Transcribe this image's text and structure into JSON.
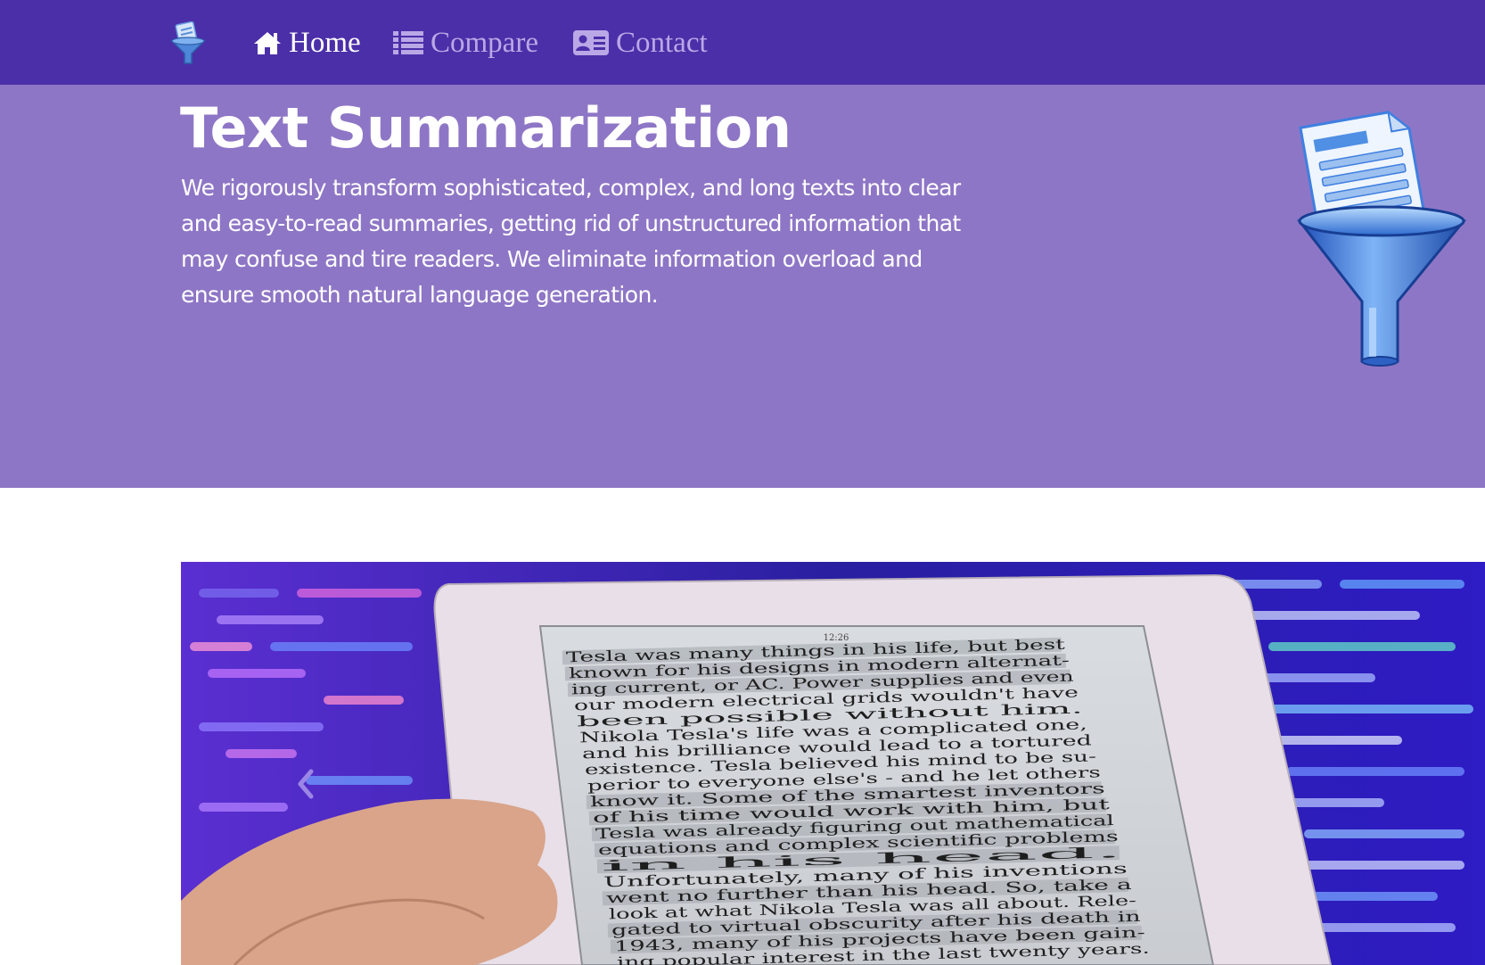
{
  "nav": {
    "brand_icon": "funnel-document-icon",
    "items": [
      {
        "label": "Home",
        "icon": "home-icon",
        "active": true
      },
      {
        "label": "Compare",
        "icon": "list-icon",
        "active": false
      },
      {
        "label": "Contact",
        "icon": "contact-card-icon",
        "active": false
      }
    ]
  },
  "hero": {
    "title": "Text Summarization",
    "description": "We rigorously transform sophisticated, complex, and long texts into clear and easy-to-read summaries, getting rid of unstructured information that may confuse and tire readers. We eliminate information overload and ensure smooth natural language generation.",
    "illustration_icon": "funnel-document-icon"
  },
  "carousel": {
    "prev_icon": "chevron-left-icon",
    "ereader": {
      "status_time": "12:26",
      "lines": [
        "Tesla was many things in his life, but best",
        "known for his designs in modern alternat-",
        "ing current, or AC. Power supplies and even",
        "our modern electrical grids wouldn't have",
        "been possible without him.",
        "Nikola Tesla's life was a complicated one,",
        "and his brilliance would lead to a tortured",
        "existence. Tesla believed his mind to be su-",
        "perior to everyone else's - and he let others",
        "know it. Some of the smartest inventors",
        "of his time would work with him, but",
        "Tesla was already figuring out mathematical",
        "equations and complex scientific problems",
        "in his head.",
        "Unfortunately, many of his inventions",
        "went no further than his head. So, take a",
        "look at what Nikola Tesla was all about. Rele-",
        "gated to virtual obscurity after his death in",
        "1943, many of his projects have been gain-",
        "ing popular interest in the last twenty years."
      ]
    }
  },
  "colors": {
    "navbar": "#4b2fa8",
    "hero": "#8e76c6",
    "nav_active": "#ffffff",
    "nav_inactive": "#b9a8e6"
  }
}
